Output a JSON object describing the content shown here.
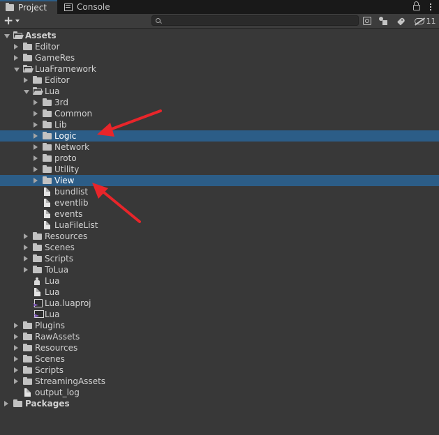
{
  "tabs": {
    "project_label": "Project",
    "console_label": "Console"
  },
  "toolbar": {
    "add_label": "+",
    "search_placeholder": "",
    "hidden_packages_count": "11"
  },
  "tree": [
    {
      "label": "Assets",
      "type": "folder",
      "state": "expanded",
      "bold": true
    },
    {
      "label": "Editor",
      "type": "folder",
      "state": "collapsed"
    },
    {
      "label": "GameRes",
      "type": "folder",
      "state": "collapsed"
    },
    {
      "label": "LuaFramework",
      "type": "folder",
      "state": "expanded"
    },
    {
      "label": "Editor",
      "type": "folder",
      "state": "collapsed"
    },
    {
      "label": "Lua",
      "type": "folder",
      "state": "expanded"
    },
    {
      "label": "3rd",
      "type": "folder",
      "state": "collapsed"
    },
    {
      "label": "Common",
      "type": "folder",
      "state": "collapsed"
    },
    {
      "label": "Lib",
      "type": "folder",
      "state": "collapsed"
    },
    {
      "label": "Logic",
      "type": "folder",
      "state": "collapsed",
      "selected": true
    },
    {
      "label": "Network",
      "type": "folder",
      "state": "collapsed"
    },
    {
      "label": "proto",
      "type": "folder",
      "state": "collapsed"
    },
    {
      "label": "Utility",
      "type": "folder",
      "state": "collapsed"
    },
    {
      "label": "View",
      "type": "folder",
      "state": "collapsed",
      "selected": true
    },
    {
      "label": "bundlist",
      "type": "file"
    },
    {
      "label": "eventlib",
      "type": "file"
    },
    {
      "label": "events",
      "type": "file"
    },
    {
      "label": "LuaFileList",
      "type": "file"
    },
    {
      "label": "Resources",
      "type": "folder",
      "state": "collapsed"
    },
    {
      "label": "Scenes",
      "type": "folder",
      "state": "collapsed"
    },
    {
      "label": "Scripts",
      "type": "folder",
      "state": "collapsed"
    },
    {
      "label": "ToLua",
      "type": "folder",
      "state": "collapsed"
    },
    {
      "label": "Lua",
      "type": "script"
    },
    {
      "label": "Lua",
      "type": "file"
    },
    {
      "label": "Lua.luaproj",
      "type": "vs"
    },
    {
      "label": "Lua",
      "type": "sln"
    },
    {
      "label": "Plugins",
      "type": "folder",
      "state": "collapsed"
    },
    {
      "label": "RawAssets",
      "type": "folder",
      "state": "collapsed"
    },
    {
      "label": "Resources",
      "type": "folder",
      "state": "collapsed"
    },
    {
      "label": "Scenes",
      "type": "folder",
      "state": "collapsed"
    },
    {
      "label": "Scripts",
      "type": "folder",
      "state": "collapsed"
    },
    {
      "label": "StreamingAssets",
      "type": "folder",
      "state": "collapsed"
    },
    {
      "label": "output_log",
      "type": "file"
    },
    {
      "label": "Packages",
      "type": "folder",
      "state": "collapsed",
      "bold": true
    }
  ],
  "colors": {
    "selection": "#2c5d87",
    "annotation_arrow": "#e8252a"
  }
}
